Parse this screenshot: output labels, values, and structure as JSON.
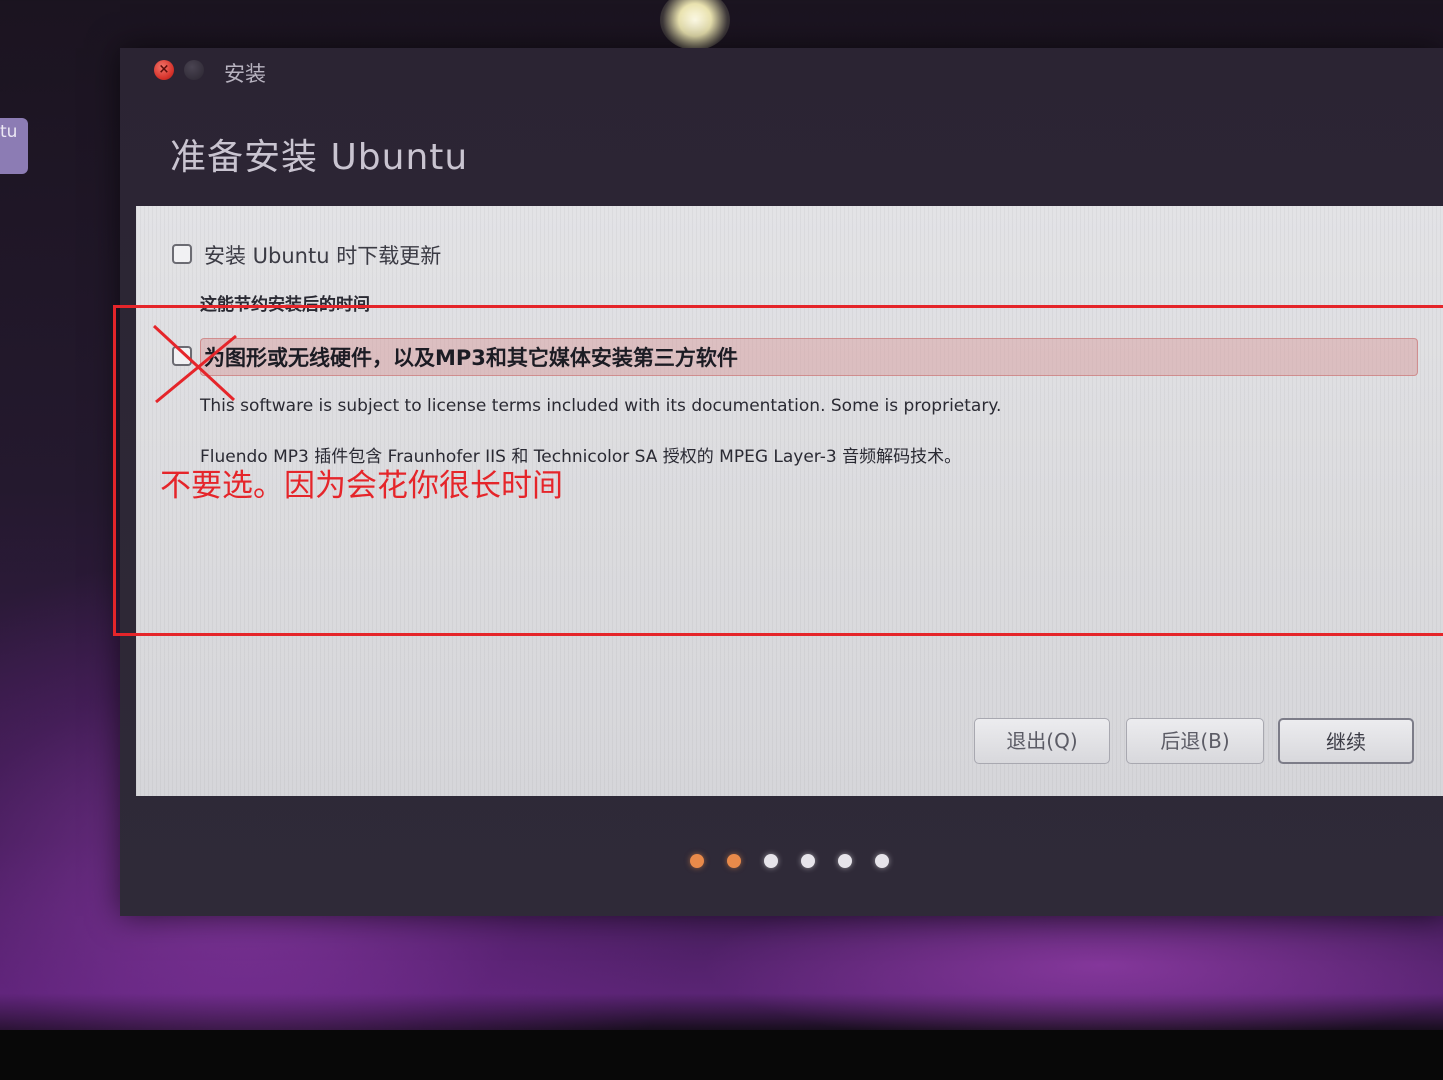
{
  "launcher": {
    "partial_label": "tu"
  },
  "window": {
    "title": "安装",
    "page_title": "准备安装 Ubuntu",
    "option_updates": {
      "label": "安装 Ubuntu 时下载更新",
      "description": "这能节约安装后的时间",
      "checked": false
    },
    "option_third_party": {
      "label": "为图形或无线硬件，以及MP3和其它媒体安装第三方软件",
      "license_note": "This software is subject to license terms included with its documentation. Some is proprietary.",
      "mp3_note": "Fluendo MP3 插件包含 Fraunhofer IIS 和 Technicolor SA 授权的 MPEG Layer-3 音频解码技术。",
      "checked": false
    },
    "buttons": {
      "quit": "退出(Q)",
      "back": "后退(B)",
      "continue": "继续"
    },
    "progress": {
      "total_steps": 6,
      "completed_steps": 2
    }
  },
  "annotation": {
    "note": "不要选。因为会花你很长时间",
    "color": "#e5252a"
  },
  "colors": {
    "accent_orange": "#e98a4a",
    "window_dark": "#2b2433",
    "content_bg": "#dcdcdf"
  }
}
